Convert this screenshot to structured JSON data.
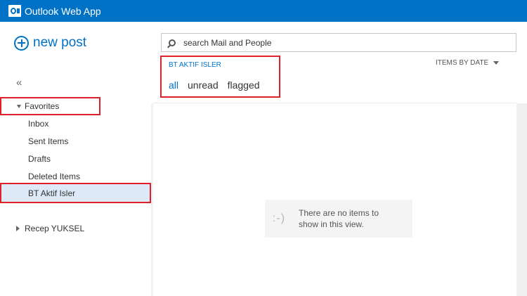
{
  "app": {
    "title": "Outlook Web App"
  },
  "actions": {
    "new_post": "new post",
    "collapse_symbol": "«"
  },
  "nav": {
    "favorites_label": "Favorites",
    "items": [
      {
        "label": "Inbox"
      },
      {
        "label": "Sent Items"
      },
      {
        "label": "Drafts"
      },
      {
        "label": "Deleted Items"
      },
      {
        "label": "BT Aktif Isler",
        "selected": true
      }
    ],
    "account_label": "Recep YUKSEL"
  },
  "search": {
    "placeholder": "search Mail and People"
  },
  "folder": {
    "title": "BT AKTIF ISLER",
    "filters": [
      {
        "label": "all",
        "active": true
      },
      {
        "label": "unread"
      },
      {
        "label": "flagged"
      }
    ]
  },
  "sort": {
    "label": "ITEMS BY DATE"
  },
  "empty_state": {
    "icon_text": ":-)",
    "message": "There are no items to show in this view."
  },
  "colors": {
    "brand": "#0072c6",
    "highlight": "#e0202b",
    "selected_bg": "#dde9f6"
  }
}
